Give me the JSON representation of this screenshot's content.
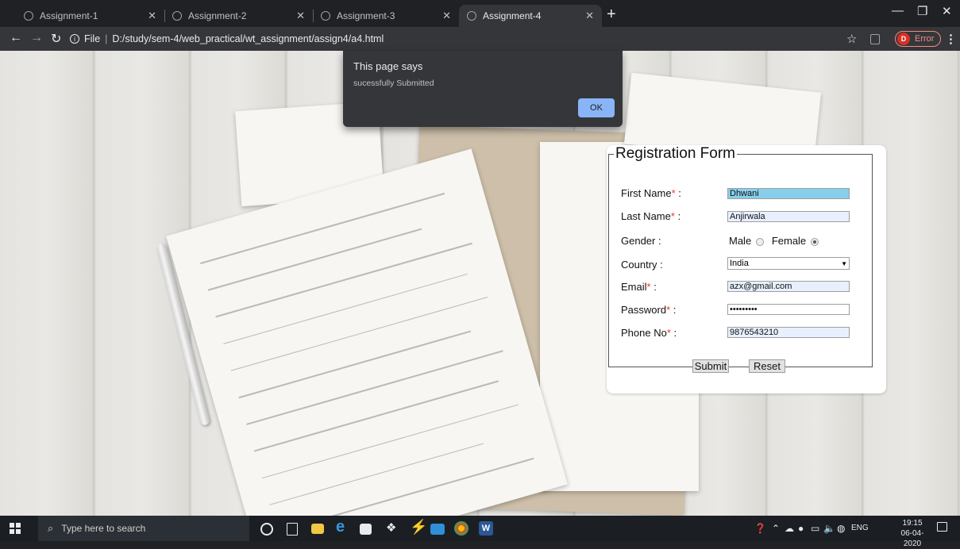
{
  "browser": {
    "tabs": [
      {
        "title": "Assignment-1",
        "active": false
      },
      {
        "title": "Assignment-2",
        "active": false
      },
      {
        "title": "Assignment-3",
        "active": false
      },
      {
        "title": "Assignment-4",
        "active": true
      }
    ],
    "new_tab_icon": "plus-icon",
    "address": {
      "scheme_label": "File",
      "path": "D:/study/sem-4/web_practical/wt_assignment/assign4/a4.html"
    },
    "profile": {
      "initial": "D",
      "status": "Error"
    }
  },
  "alert": {
    "title": "This page says",
    "message": "sucessfully Submitted",
    "ok_label": "OK",
    "accent": "#8ab4f8"
  },
  "form": {
    "legend": "Registration Form",
    "first_name": {
      "label": "First Name",
      "required_mark": "*",
      "value": "Dhwani"
    },
    "last_name": {
      "label": "Last Name",
      "required_mark": "*",
      "value": "Anjirwala"
    },
    "gender": {
      "label": "Gender",
      "option_male": "Male",
      "option_female": "Female",
      "selected": "Female"
    },
    "country": {
      "label": "Country",
      "value": "India"
    },
    "email": {
      "label": "Email",
      "required_mark": "*",
      "value": "azx@gmail.com"
    },
    "password": {
      "label": "Password",
      "required_mark": "*",
      "masked_value": "•••••••••"
    },
    "phone": {
      "label": "Phone No",
      "required_mark": "*",
      "value": "9876543210"
    },
    "colon": ":",
    "submit_label": "Submit",
    "reset_label": "Reset"
  },
  "taskbar": {
    "search_placeholder": "Type here to search",
    "language": "ENG",
    "time": "19:15",
    "date": "06-04-2020"
  }
}
